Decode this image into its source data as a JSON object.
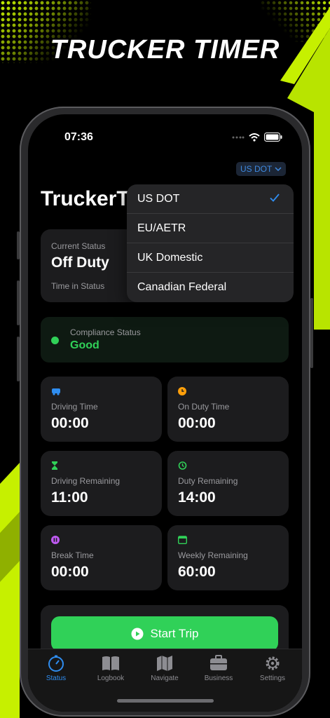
{
  "headline": "TRUCKER TIMER",
  "status_bar": {
    "time": "07:36"
  },
  "region_button": {
    "label": "US DOT"
  },
  "app_title": "TruckerT",
  "current_status": {
    "label": "Current Status",
    "value": "Off Duty",
    "time_label": "Time in Status"
  },
  "region_menu": {
    "items": [
      {
        "label": "US DOT",
        "selected": true
      },
      {
        "label": "EU/AETR",
        "selected": false
      },
      {
        "label": "UK Domestic",
        "selected": false
      },
      {
        "label": "Canadian Federal",
        "selected": false
      }
    ]
  },
  "compliance": {
    "label": "Compliance Status",
    "value": "Good"
  },
  "stats": [
    {
      "label": "Driving Time",
      "value": "00:00",
      "icon": "truck-icon",
      "color": "#2f8df0"
    },
    {
      "label": "On Duty Time",
      "value": "00:00",
      "icon": "clock-icon",
      "color": "#ff9f0a"
    },
    {
      "label": "Driving Remaining",
      "value": "11:00",
      "icon": "hourglass-icon",
      "color": "#30d158"
    },
    {
      "label": "Duty Remaining",
      "value": "14:00",
      "icon": "timer-icon",
      "color": "#30d158"
    },
    {
      "label": "Break Time",
      "value": "00:00",
      "icon": "pause-icon",
      "color": "#bf5af2"
    },
    {
      "label": "Weekly Remaining",
      "value": "60:00",
      "icon": "calendar-icon",
      "color": "#30d158"
    }
  ],
  "start_button": {
    "label": "Start Trip"
  },
  "tabs": [
    {
      "label": "Status",
      "icon": "gauge-icon",
      "active": true
    },
    {
      "label": "Logbook",
      "icon": "book-icon",
      "active": false
    },
    {
      "label": "Navigate",
      "icon": "map-icon",
      "active": false
    },
    {
      "label": "Business",
      "icon": "briefcase-icon",
      "active": false
    },
    {
      "label": "Settings",
      "icon": "gear-icon",
      "active": false
    }
  ],
  "colors": {
    "accent_green": "#30d158",
    "accent_blue": "#2f8df0",
    "lime": "#c6f000"
  }
}
